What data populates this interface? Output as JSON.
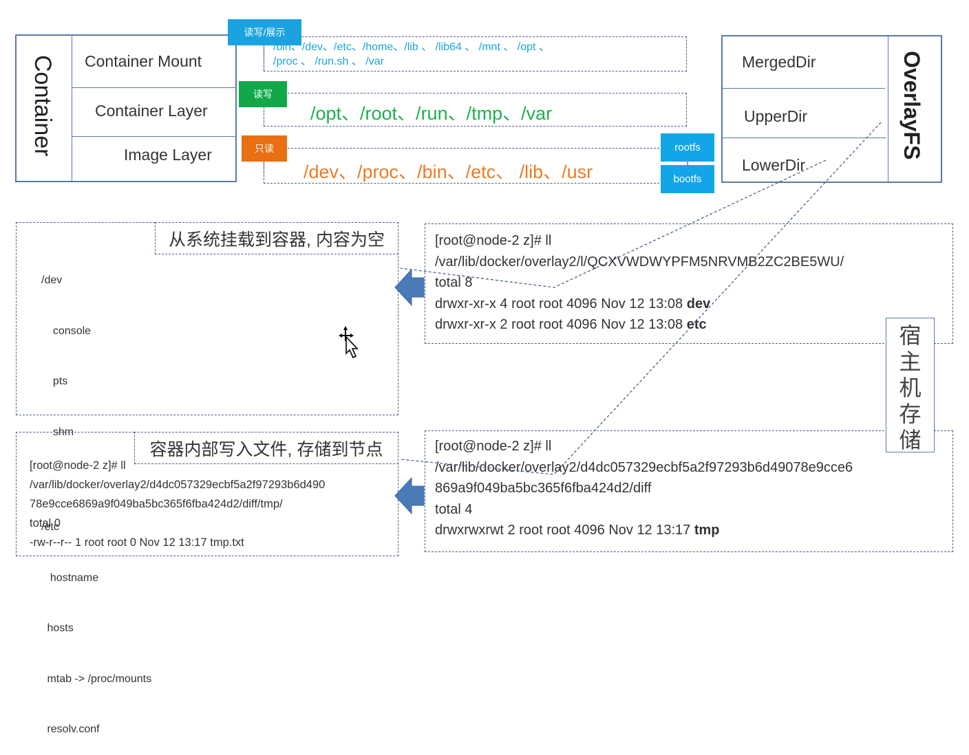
{
  "container_stack": {
    "title": "Container",
    "rows": [
      "Container Mount",
      "Container Layer",
      "Image Layer"
    ]
  },
  "layers": [
    {
      "tag": "读写/展示",
      "tag_color": "#1aa3e0",
      "text_color": "#1aa3e0",
      "lines": [
        "/bin、/dev、/etc、/home、/lib 、 /lib64 、 /mnt 、 /opt 、",
        "/proc 、 /run.sh 、 /var"
      ]
    },
    {
      "tag": "读写",
      "tag_color": "#12a84a",
      "text_color": "#1db04f",
      "lines": [
        "/opt、/root、/run、/tmp、/var"
      ]
    },
    {
      "tag": "只读",
      "tag_color": "#e86f12",
      "text_color": "#ec7b27",
      "lines": [
        "/dev、/proc、/bin、/etc、 /lib、/usr"
      ]
    }
  ],
  "fs_tags": [
    "rootfs",
    "bootfs"
  ],
  "fs_tag_color": "#12a6e8",
  "overlayfs": {
    "title": "OverlayFS",
    "rows": [
      "MergedDir",
      "UpperDir",
      "LowerDir"
    ]
  },
  "mount_panel": {
    "note": "从系统挂载到容器, 内容为空",
    "tree": [
      "/dev",
      "  console",
      "  pts",
      "  shm",
      "",
      "/etc",
      "  hostname",
      " hosts",
      " mtab -> /proc/mounts",
      " resolv.conf"
    ]
  },
  "host_panel_top": {
    "lines": [
      {
        "text": "[root@node-2 z]# ll",
        "bold": ""
      },
      {
        "text": "/var/lib/docker/overlay2/l/QCXVWDWYPFM5NRVMB2ZC2BE5WU/",
        "bold": ""
      },
      {
        "text": "total 8",
        "bold": ""
      },
      {
        "text": "drwxr-xr-x 4 root root 4096 Nov 12 13:08 ",
        "bold": "dev"
      },
      {
        "text": "drwxr-xr-x 2 root root 4096 Nov 12 13:08 ",
        "bold": "etc"
      }
    ]
  },
  "write_panel": {
    "note": "容器内部写入文件, 存储到节点",
    "lines": [
      "[root@node-2 z]# ll",
      "/var/lib/docker/overlay2/d4dc057329ecbf5a2f97293b6d490",
      "78e9cce6869a9f049ba5bc365f6fba424d2/diff/tmp/",
      "total 0",
      "-rw-r--r-- 1 root root 0 Nov 12 13:17 tmp.txt"
    ]
  },
  "host_panel_bottom": {
    "lines": [
      {
        "text": "[root@node-2 z]# ll",
        "bold": ""
      },
      {
        "text": "/var/lib/docker/overlay2/d4dc057329ecbf5a2f97293b6d49078e9cce6",
        "bold": ""
      },
      {
        "text": "869a9f049ba5bc365f6fba424d2/diff",
        "bold": ""
      },
      {
        "text": "total 4",
        "bold": ""
      },
      {
        "text": "drwxrwxrwt 2 root root 4096 Nov 12 13:17 ",
        "bold": "tmp"
      }
    ]
  },
  "host_storage_label": "宿主机存储",
  "arrow_color": "#4a7ab8"
}
